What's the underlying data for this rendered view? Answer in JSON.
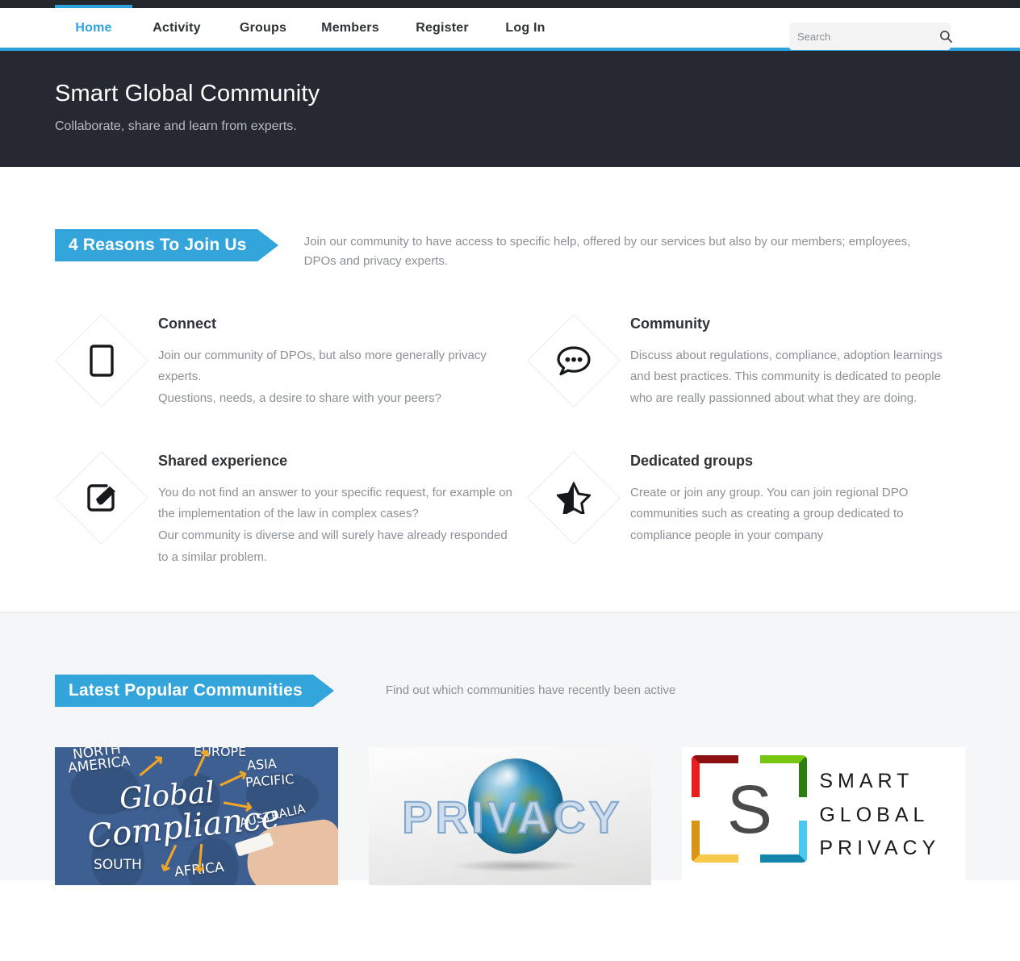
{
  "nav": {
    "items": [
      {
        "label": "Home",
        "active": true
      },
      {
        "label": "Activity",
        "active": false
      },
      {
        "label": "Groups",
        "active": false
      },
      {
        "label": "Members",
        "active": false
      },
      {
        "label": "Register",
        "active": false
      },
      {
        "label": "Log In",
        "active": false
      }
    ],
    "accent_color": "#2ea3db"
  },
  "search": {
    "placeholder": "Search",
    "value": "",
    "icon": "search-icon"
  },
  "hero": {
    "title": "Smart Global Community",
    "subtitle": "Collaborate, share and learn from experts.",
    "background": "#252a32"
  },
  "reasons": {
    "ribbon_label": "4 Reasons To Join Us",
    "description": "Join our community to have access to specific help, offered by our services but also by our members; employees, DPOs and privacy experts.",
    "ribbon_color": "#34a5db",
    "features": [
      {
        "icon": "tablet-icon",
        "title": "Connect",
        "text": "Join our community of DPOs, but also more generally privacy experts.\nQuestions, needs, a desire to share with your peers?"
      },
      {
        "icon": "speech-bubble-icon",
        "title": "Community",
        "text": "Discuss about regulations, compliance, adoption learnings and best practices. This community is dedicated to people who are really passionned about what they are doing."
      },
      {
        "icon": "edit-pencil-icon",
        "title": "Shared experience",
        "text": "You do not find an answer to your specific request, for example on the implementation of the law in complex cases?\nOur community is diverse and will surely have already responded to a similar problem."
      },
      {
        "icon": "half-star-icon",
        "title": "Dedicated groups",
        "text": "Create or join any group. You can join regional DPO communities such as creating a group dedicated to compliance people in your company"
      }
    ]
  },
  "communities": {
    "ribbon_label": "Latest Popular Communities",
    "description": "Find out which communities have recently been active",
    "cards": [
      {
        "name": "global-compliance-card",
        "image_alt": "Global Compliance",
        "image_texts": {
          "word1": "Global",
          "word2": "Compliance",
          "north": "NORTH",
          "america": "AMERICA",
          "europe": "EUROPE",
          "asia": "ASIA",
          "pacific": "PACIFIC",
          "australia": "AUSTRALIA",
          "south": "SOUTH",
          "africa": "AFRICA"
        }
      },
      {
        "name": "privacy-card",
        "image_alt": "Privacy",
        "image_texts": {
          "word": "PRIVACY"
        }
      },
      {
        "name": "smart-global-privacy-card",
        "image_alt": "Smart Global Privacy",
        "image_texts": {
          "monogram": "S",
          "line1": "SMART",
          "line2": "GLOBAL",
          "line3": "PRIVACY"
        }
      }
    ]
  }
}
